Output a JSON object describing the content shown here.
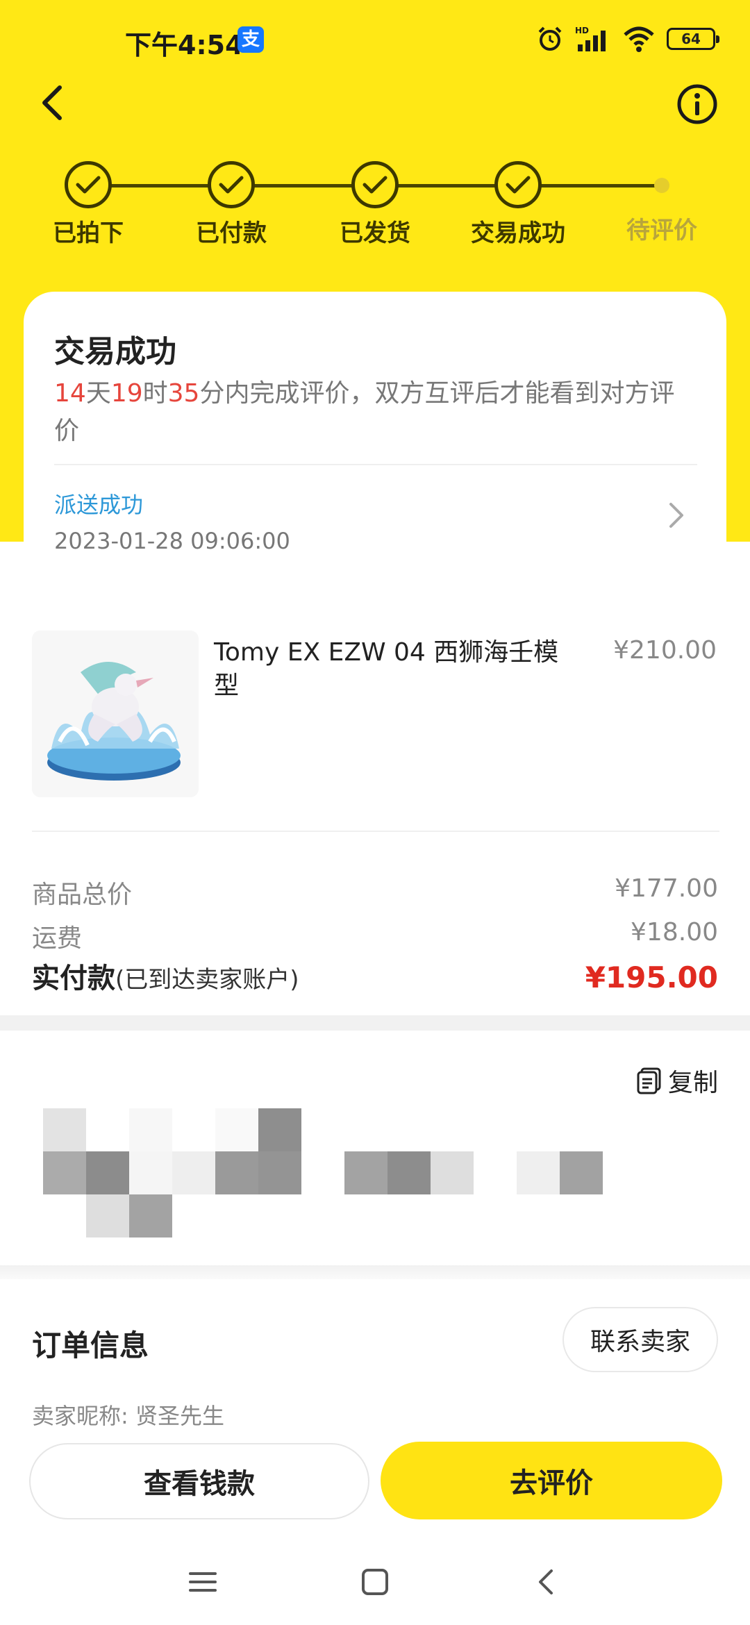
{
  "status_bar": {
    "time": "下午4:54",
    "app_badge": "支",
    "battery": "64",
    "signal_label": "HD",
    "icons": [
      "alarm-icon",
      "signal-icon",
      "wifi-icon",
      "battery-icon"
    ]
  },
  "header": {
    "back_icon": "chevron-left-icon",
    "info_icon": "info-circle-icon"
  },
  "steps": [
    {
      "label": "已拍下",
      "done": true
    },
    {
      "label": "已付款",
      "done": true
    },
    {
      "label": "已发货",
      "done": true
    },
    {
      "label": "交易成功",
      "done": true
    },
    {
      "label": "待评价",
      "done": false
    }
  ],
  "status_card": {
    "title": "交易成功",
    "countdown": {
      "days": "14",
      "days_unit": "天",
      "hours": "19",
      "hours_unit": "时",
      "minutes": "35",
      "rest": "分内完成评价，双方互评后才能看到对方评价"
    },
    "delivery_status": "派送成功",
    "delivery_time": "2023-01-28 09:06:00"
  },
  "product": {
    "title": "Tomy EX EZW 04 西狮海壬模型",
    "price": "¥210.00"
  },
  "pricing": {
    "subtotal_label": "商品总价",
    "subtotal_value": "¥177.00",
    "shipping_label": "运费",
    "shipping_value": "¥18.00",
    "paid_label": "实付款",
    "paid_note": "(已到达卖家账户)",
    "paid_value": "¥195.00"
  },
  "address": {
    "copy_label": "复制"
  },
  "order_info": {
    "title": "订单信息",
    "contact_seller": "联系卖家",
    "seller_nick": "卖家昵称: 贤圣先生"
  },
  "actions": {
    "view_payment": "查看钱款",
    "review": "去评价"
  },
  "colors": {
    "brand_yellow": "#ffe815",
    "countdown_red": "#e6453c",
    "price_red": "#e02a20",
    "link_blue": "#2d98d8"
  }
}
